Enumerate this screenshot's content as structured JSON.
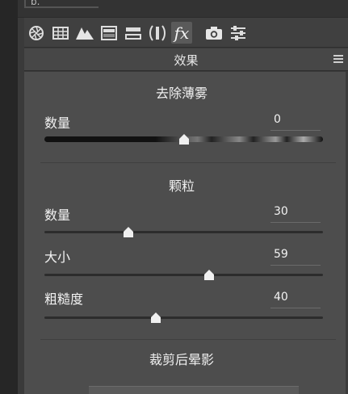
{
  "window": {
    "tab_text": "b."
  },
  "toolbar": {
    "icons": [
      {
        "name": "aperture-icon"
      },
      {
        "name": "grid-icon"
      },
      {
        "name": "mountain-icon"
      },
      {
        "name": "hsl-panel-icon"
      },
      {
        "name": "split-tone-icon"
      },
      {
        "name": "lens-correction-icon"
      },
      {
        "name": "fx-icon",
        "label": "fx",
        "active": true
      },
      {
        "name": "camera-icon"
      },
      {
        "name": "sliders-icon"
      }
    ]
  },
  "header": {
    "title": "效果"
  },
  "dehaze": {
    "title": "去除薄雾",
    "amount_label": "数量",
    "amount_value": "0",
    "amount": 0,
    "range": [
      -100,
      100
    ]
  },
  "grain": {
    "title": "颗粒",
    "amount_label": "数量",
    "amount_value": "30",
    "amount": 30,
    "size_label": "大小",
    "size_value": "59",
    "size": 59,
    "roughness_label": "粗糙度",
    "roughness_value": "40",
    "roughness": 40
  },
  "vignette": {
    "title": "裁剪后晕影"
  },
  "colors": {
    "panel": "#4d4d4d",
    "header": "#474747",
    "track": "#2c2c2c"
  }
}
